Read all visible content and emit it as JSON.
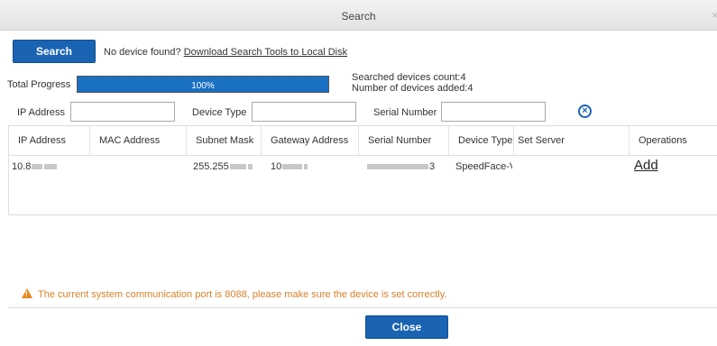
{
  "window": {
    "title": "Search",
    "close_glyph": "×"
  },
  "search_button": {
    "label": "Search"
  },
  "no_device": {
    "text": "No device found?",
    "link": "Download Search Tools to Local Disk"
  },
  "progress": {
    "label": "Total Progress",
    "value_text": "100%",
    "value": 100
  },
  "stats": {
    "searched": "Searched devices count:4",
    "added": "Number of devices added:4"
  },
  "filters": {
    "ip_label": "IP Address",
    "ip_value": "",
    "type_label": "Device Type",
    "type_value": "",
    "serial_label": "Serial Number",
    "serial_value": "",
    "clear_icon": "clear-circle-icon"
  },
  "table": {
    "columns": [
      "IP Address",
      "MAC Address",
      "Subnet Mask",
      "Gateway Address",
      "Serial Number",
      "Device Type",
      "Set Server",
      "Operations"
    ],
    "row": {
      "ip": "10.8",
      "mac": "",
      "subnet": "255.255",
      "gateway": "10",
      "serial_end": "3",
      "device_type": "SpeedFace-V!",
      "set_server": "",
      "operation": "Add"
    }
  },
  "warning": {
    "text": "The current system communication port is 8088, please make sure the device is set correctly.",
    "color": "#d9822b"
  },
  "close_button": {
    "label": "Close"
  },
  "colors": {
    "accent": "#1a63b3",
    "progress": "#1a70c2"
  }
}
